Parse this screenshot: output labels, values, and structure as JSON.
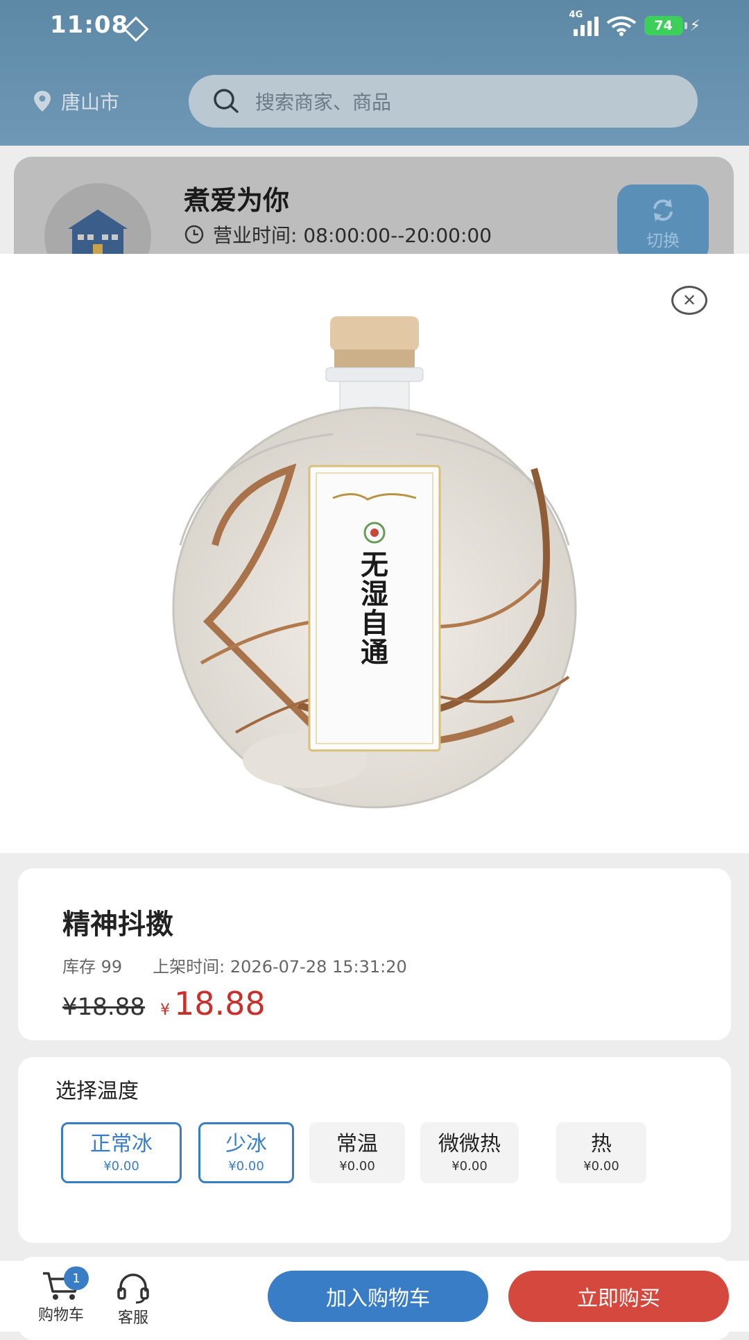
{
  "status_bar": {
    "time": "11:08",
    "network": "4G",
    "battery": "74"
  },
  "header": {
    "location": "唐山市",
    "search_placeholder": "搜索商家、商品"
  },
  "shop": {
    "name": "煮爱为你",
    "hours": "营业时间: 08:00:00--20:00:00",
    "switch_label": "切换"
  },
  "product": {
    "image_icon": "product-bottle-image",
    "name": "精神抖擞",
    "stock": "库存 99",
    "listed_time": "上架时间: 2026-07-28 15:31:20",
    "original_price": "¥18.88",
    "currency": "¥",
    "price": "18.88"
  },
  "temperature": {
    "title": "选择温度",
    "options": [
      {
        "label": "正常冰",
        "price": "¥0.00",
        "selected": true
      },
      {
        "label": "少冰",
        "price": "¥0.00",
        "selected": true
      },
      {
        "label": "常温",
        "price": "¥0.00",
        "selected": false
      },
      {
        "label": "微微热",
        "price": "¥0.00",
        "selected": false
      },
      {
        "label": "热",
        "price": "¥0.00",
        "selected": false
      }
    ]
  },
  "bottom_bar": {
    "cart_label": "购物车",
    "cart_count": "1",
    "service_label": "客服",
    "add_to_cart": "加入购物车",
    "buy_now": "立即购买"
  },
  "colors": {
    "accent": "#3a7dc7",
    "price": "#c8302b",
    "buy": "#d4483e",
    "header": "#6f98b6"
  }
}
